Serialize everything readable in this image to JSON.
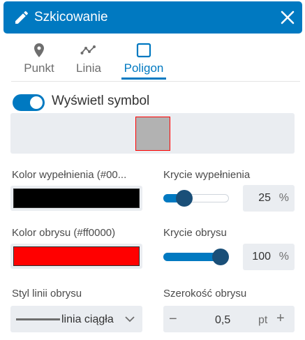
{
  "header": {
    "title": "Szkicowanie",
    "icon": "pencil-icon",
    "close_icon": "close-icon",
    "background": "#0079c1"
  },
  "tabs": [
    {
      "label": "Punkt",
      "icon": "map-pin-icon",
      "active": false
    },
    {
      "label": "Linia",
      "icon": "polyline-icon",
      "active": false
    },
    {
      "label": "Poligon",
      "icon": "square-icon",
      "active": true
    }
  ],
  "display_symbol": {
    "label": "Wyświetl symbol",
    "on": true
  },
  "preview": {
    "fill": "#b2b2b2",
    "outline": "#ff0000"
  },
  "fill_color": {
    "label": "Kolor wypełnienia (#00...",
    "value": "#000000"
  },
  "fill_opacity": {
    "label": "Krycie wypełnienia",
    "value": "25",
    "unit": "%",
    "level": 0.25
  },
  "outline_color": {
    "label": "Kolor obrysu (#ff0000)",
    "value": "#ff0000"
  },
  "outline_opacity": {
    "label": "Krycie obrysu",
    "value": "100",
    "unit": "%",
    "level": 1.0
  },
  "outline_style": {
    "label": "Styl linii obrysu",
    "value": "linia ciągła"
  },
  "outline_width": {
    "label": "Szerokość obrysu",
    "value": "0,5",
    "unit": "pt",
    "minus": "−",
    "plus": "+"
  }
}
